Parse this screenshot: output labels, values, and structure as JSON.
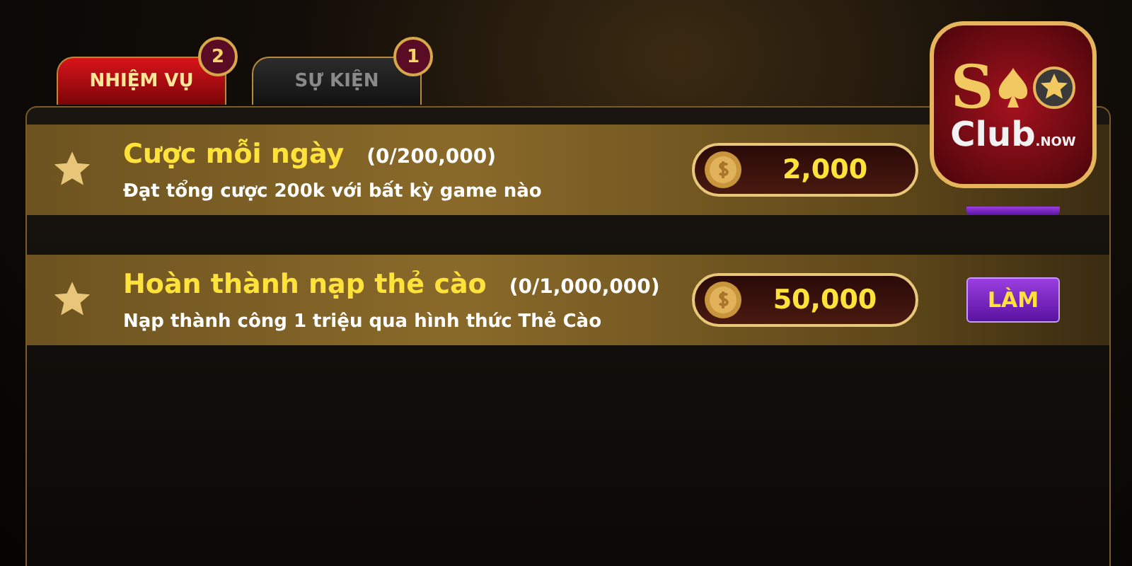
{
  "tabs": [
    {
      "label": "NHIỆM VỤ",
      "selected": true,
      "badge": "2"
    },
    {
      "label": "SỰ KIỆN",
      "selected": false,
      "badge": "1"
    }
  ],
  "tasks": [
    {
      "title": "Cược mỗi ngày",
      "count": "(0/200,000)",
      "description": "Đạt tổng cược 200k với bất kỳ game nào",
      "reward": "2,000",
      "button": {
        "covered": true
      }
    },
    {
      "title": "Hoàn thành nạp thẻ cào",
      "count": "(0/1,000,000)",
      "description": "Nạp thành công 1 triệu qua hình thức Thẻ Cào",
      "reward": "50,000",
      "button": {
        "covered": false,
        "label": "LÀM"
      }
    }
  ],
  "logo": {
    "initial": "S",
    "word": "Club",
    "suffix": ".NOW"
  }
}
